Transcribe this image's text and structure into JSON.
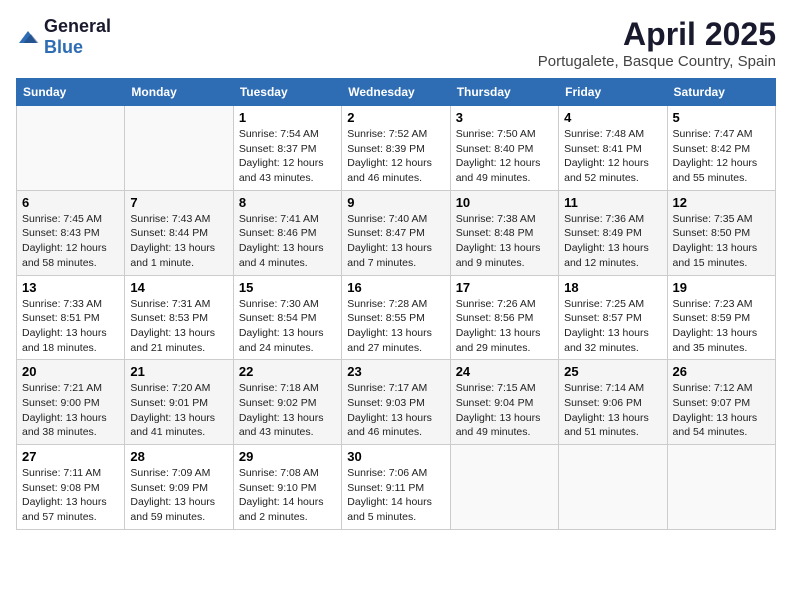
{
  "logo": {
    "general": "General",
    "blue": "Blue"
  },
  "title": "April 2025",
  "subtitle": "Portugalete, Basque Country, Spain",
  "headers": [
    "Sunday",
    "Monday",
    "Tuesday",
    "Wednesday",
    "Thursday",
    "Friday",
    "Saturday"
  ],
  "weeks": [
    [
      {
        "day": "",
        "info": ""
      },
      {
        "day": "",
        "info": ""
      },
      {
        "day": "1",
        "info": "Sunrise: 7:54 AM\nSunset: 8:37 PM\nDaylight: 12 hours and 43 minutes."
      },
      {
        "day": "2",
        "info": "Sunrise: 7:52 AM\nSunset: 8:39 PM\nDaylight: 12 hours and 46 minutes."
      },
      {
        "day": "3",
        "info": "Sunrise: 7:50 AM\nSunset: 8:40 PM\nDaylight: 12 hours and 49 minutes."
      },
      {
        "day": "4",
        "info": "Sunrise: 7:48 AM\nSunset: 8:41 PM\nDaylight: 12 hours and 52 minutes."
      },
      {
        "day": "5",
        "info": "Sunrise: 7:47 AM\nSunset: 8:42 PM\nDaylight: 12 hours and 55 minutes."
      }
    ],
    [
      {
        "day": "6",
        "info": "Sunrise: 7:45 AM\nSunset: 8:43 PM\nDaylight: 12 hours and 58 minutes."
      },
      {
        "day": "7",
        "info": "Sunrise: 7:43 AM\nSunset: 8:44 PM\nDaylight: 13 hours and 1 minute."
      },
      {
        "day": "8",
        "info": "Sunrise: 7:41 AM\nSunset: 8:46 PM\nDaylight: 13 hours and 4 minutes."
      },
      {
        "day": "9",
        "info": "Sunrise: 7:40 AM\nSunset: 8:47 PM\nDaylight: 13 hours and 7 minutes."
      },
      {
        "day": "10",
        "info": "Sunrise: 7:38 AM\nSunset: 8:48 PM\nDaylight: 13 hours and 9 minutes."
      },
      {
        "day": "11",
        "info": "Sunrise: 7:36 AM\nSunset: 8:49 PM\nDaylight: 13 hours and 12 minutes."
      },
      {
        "day": "12",
        "info": "Sunrise: 7:35 AM\nSunset: 8:50 PM\nDaylight: 13 hours and 15 minutes."
      }
    ],
    [
      {
        "day": "13",
        "info": "Sunrise: 7:33 AM\nSunset: 8:51 PM\nDaylight: 13 hours and 18 minutes."
      },
      {
        "day": "14",
        "info": "Sunrise: 7:31 AM\nSunset: 8:53 PM\nDaylight: 13 hours and 21 minutes."
      },
      {
        "day": "15",
        "info": "Sunrise: 7:30 AM\nSunset: 8:54 PM\nDaylight: 13 hours and 24 minutes."
      },
      {
        "day": "16",
        "info": "Sunrise: 7:28 AM\nSunset: 8:55 PM\nDaylight: 13 hours and 27 minutes."
      },
      {
        "day": "17",
        "info": "Sunrise: 7:26 AM\nSunset: 8:56 PM\nDaylight: 13 hours and 29 minutes."
      },
      {
        "day": "18",
        "info": "Sunrise: 7:25 AM\nSunset: 8:57 PM\nDaylight: 13 hours and 32 minutes."
      },
      {
        "day": "19",
        "info": "Sunrise: 7:23 AM\nSunset: 8:59 PM\nDaylight: 13 hours and 35 minutes."
      }
    ],
    [
      {
        "day": "20",
        "info": "Sunrise: 7:21 AM\nSunset: 9:00 PM\nDaylight: 13 hours and 38 minutes."
      },
      {
        "day": "21",
        "info": "Sunrise: 7:20 AM\nSunset: 9:01 PM\nDaylight: 13 hours and 41 minutes."
      },
      {
        "day": "22",
        "info": "Sunrise: 7:18 AM\nSunset: 9:02 PM\nDaylight: 13 hours and 43 minutes."
      },
      {
        "day": "23",
        "info": "Sunrise: 7:17 AM\nSunset: 9:03 PM\nDaylight: 13 hours and 46 minutes."
      },
      {
        "day": "24",
        "info": "Sunrise: 7:15 AM\nSunset: 9:04 PM\nDaylight: 13 hours and 49 minutes."
      },
      {
        "day": "25",
        "info": "Sunrise: 7:14 AM\nSunset: 9:06 PM\nDaylight: 13 hours and 51 minutes."
      },
      {
        "day": "26",
        "info": "Sunrise: 7:12 AM\nSunset: 9:07 PM\nDaylight: 13 hours and 54 minutes."
      }
    ],
    [
      {
        "day": "27",
        "info": "Sunrise: 7:11 AM\nSunset: 9:08 PM\nDaylight: 13 hours and 57 minutes."
      },
      {
        "day": "28",
        "info": "Sunrise: 7:09 AM\nSunset: 9:09 PM\nDaylight: 13 hours and 59 minutes."
      },
      {
        "day": "29",
        "info": "Sunrise: 7:08 AM\nSunset: 9:10 PM\nDaylight: 14 hours and 2 minutes."
      },
      {
        "day": "30",
        "info": "Sunrise: 7:06 AM\nSunset: 9:11 PM\nDaylight: 14 hours and 5 minutes."
      },
      {
        "day": "",
        "info": ""
      },
      {
        "day": "",
        "info": ""
      },
      {
        "day": "",
        "info": ""
      }
    ]
  ]
}
